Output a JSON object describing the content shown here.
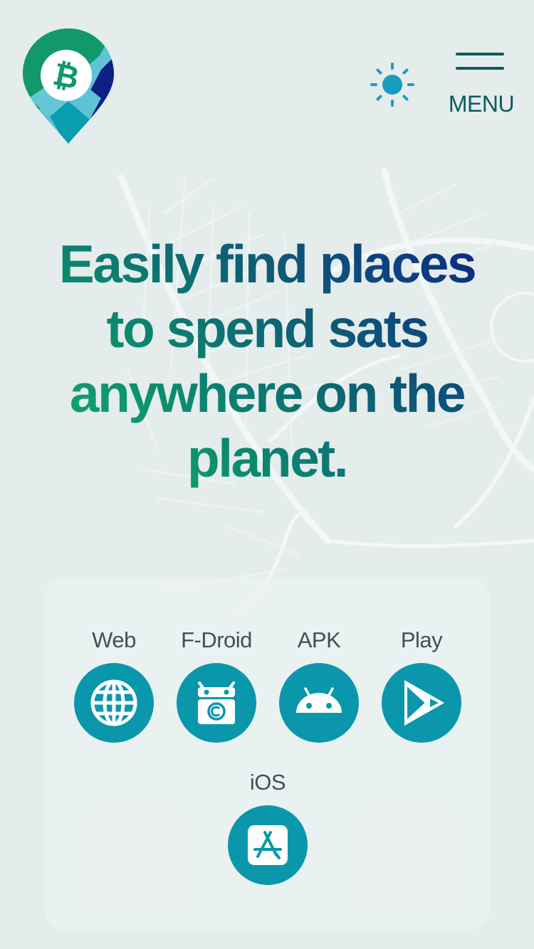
{
  "header": {
    "logo": "btc-map-logo",
    "theme_toggle_icon": "sun-icon",
    "menu_label": "MENU"
  },
  "hero": {
    "line1": "Easily find places",
    "line2": "to spend sats",
    "line3": "anywhere on the",
    "line4": "planet."
  },
  "platforms": [
    {
      "label": "Web",
      "icon": "globe-icon"
    },
    {
      "label": "F-Droid",
      "icon": "fdroid-icon"
    },
    {
      "label": "APK",
      "icon": "android-icon"
    },
    {
      "label": "Play",
      "icon": "google-play-icon"
    },
    {
      "label": "iOS",
      "icon": "app-store-icon"
    }
  ],
  "colors": {
    "background": "#e4ecec",
    "accent": "#0a97ac",
    "menu": "#0f5a63",
    "gradient_start": "#1db46f",
    "gradient_end": "#0b1e7e",
    "sun": "#1a9cc0"
  }
}
